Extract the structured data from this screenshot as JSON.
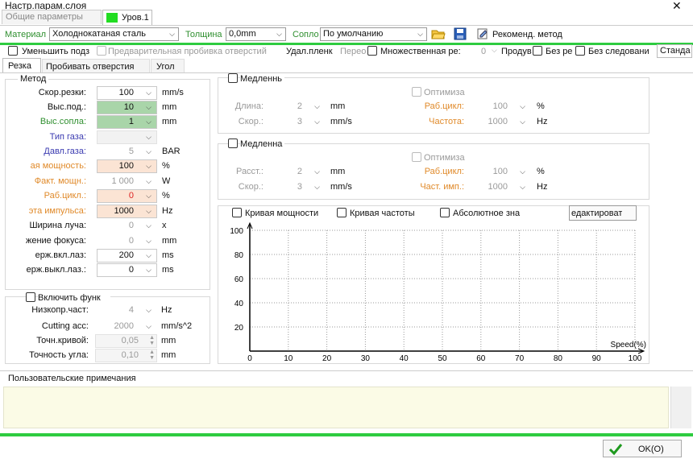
{
  "window": {
    "title": "Настр.парам.слоя",
    "close": "✕"
  },
  "tabs": [
    {
      "label": "Общие параметры"
    },
    {
      "label": "Уров.1",
      "color": "#22dd22"
    }
  ],
  "toolbar": {
    "material_label": "Материал",
    "material_value": "Холоднокатаная сталь",
    "thickness_label": "Толщина",
    "thickness_value": "0,0mm",
    "nozzle_label": "Сопло",
    "nozzle_value": "По умолчанию",
    "recommend_label": "Рекоменд. метод"
  },
  "options": {
    "reduce": "Уменьшить подз",
    "prepierce": "Предварительная пробивка отверстий",
    "film": "Удал.пленк",
    "cross": "Перео",
    "multiple": "Множественная ре:",
    "multiple_value": "0",
    "prod": "Продув",
    "no_ref": "Без ре:",
    "no_follow": "Без следовани",
    "standard": "Станда"
  },
  "subtabs": [
    "Резка",
    "Пробивать отверстия",
    "Угол"
  ],
  "method": {
    "title": "Метод",
    "rows": [
      {
        "label": "Скор.резки:",
        "value": "100",
        "unit": "mm/s"
      },
      {
        "label": "Выс.под.:",
        "value": "10",
        "unit": "mm"
      },
      {
        "label": "Выс.сопла:",
        "value": "1",
        "unit": "mm"
      },
      {
        "label": "Тип газа:",
        "value": "",
        "unit": ""
      },
      {
        "label": "Давл.газа:",
        "value": "5",
        "unit": "BAR"
      },
      {
        "label": "ая мощность:",
        "value": "100",
        "unit": "%"
      },
      {
        "label": "Факт. мощн.:",
        "value": "1 000",
        "unit": "W"
      },
      {
        "label": "Раб.цикл.:",
        "value": "0",
        "unit": "%"
      },
      {
        "label": "эта импульса:",
        "value": "1000",
        "unit": "Hz"
      },
      {
        "label": "Ширина луча:",
        "value": "0",
        "unit": "x"
      },
      {
        "label": "жение фокуса:",
        "value": "0",
        "unit": "mm"
      },
      {
        "label": "ерж.вкл.лаз:",
        "value": "200",
        "unit": "ms"
      },
      {
        "label": "ерж.выкл.лаз.:",
        "value": "0",
        "unit": "ms"
      }
    ]
  },
  "func": {
    "label": "Включить функ",
    "rows": [
      {
        "label": "Низкопр.част:",
        "value": "4",
        "unit": "Hz"
      },
      {
        "label": "Cutting acc:",
        "value": "2000",
        "unit": "mm/s^2"
      },
      {
        "label": "Точн.кривой:",
        "value": "0,05",
        "unit": "mm"
      },
      {
        "label": "Точность угла:",
        "value": "0,10",
        "unit": "mm"
      }
    ]
  },
  "slow1": {
    "label": "Медленнь",
    "optimize": "Оптимиза",
    "length_label": "Длина:",
    "length_value": "2",
    "length_unit": "mm",
    "speed_label": "Скор.:",
    "speed_value": "3",
    "speed_unit": "mm/s",
    "duty_label": "Раб.цикл:",
    "duty_value": "100",
    "duty_unit": "%",
    "freq_label": "Частота:",
    "freq_value": "1000",
    "freq_unit": "Hz"
  },
  "slow2": {
    "label": "Медленна",
    "optimize": "Оптимиза",
    "dist_label": "Расст.:",
    "dist_value": "2",
    "dist_unit": "mm",
    "speed_label": "Скор.:",
    "speed_value": "3",
    "speed_unit": "mm/s",
    "duty_label": "Раб.цикл:",
    "duty_value": "100",
    "duty_unit": "%",
    "freq_label": "Част. имп.:",
    "freq_value": "1000",
    "freq_unit": "Hz"
  },
  "curves": {
    "power": "Кривая мощности",
    "freq": "Кривая частоты",
    "absolute": "Абсолютное зна",
    "edit": "едактироват"
  },
  "chart_data": {
    "type": "line",
    "xlabel": "Speed(%)",
    "ylabel": "",
    "xlim": [
      0,
      100
    ],
    "ylim": [
      0,
      100
    ],
    "xticks": [
      "0",
      "10",
      "20",
      "30",
      "40",
      "50",
      "60",
      "70",
      "80",
      "90",
      "100"
    ],
    "yticks": [
      "20",
      "40",
      "60",
      "80",
      "100"
    ],
    "grid": true,
    "series": []
  },
  "notes": {
    "label": "Пользовательские примечания",
    "value": ""
  },
  "footer": {
    "ok": "OK(O)"
  },
  "colors": {
    "accent": "#2ecc40",
    "input_green": "#a9d5a9",
    "input_pink": "#fbe4d4",
    "orange": "#e08a2a",
    "blue": "#3a3ab0"
  }
}
